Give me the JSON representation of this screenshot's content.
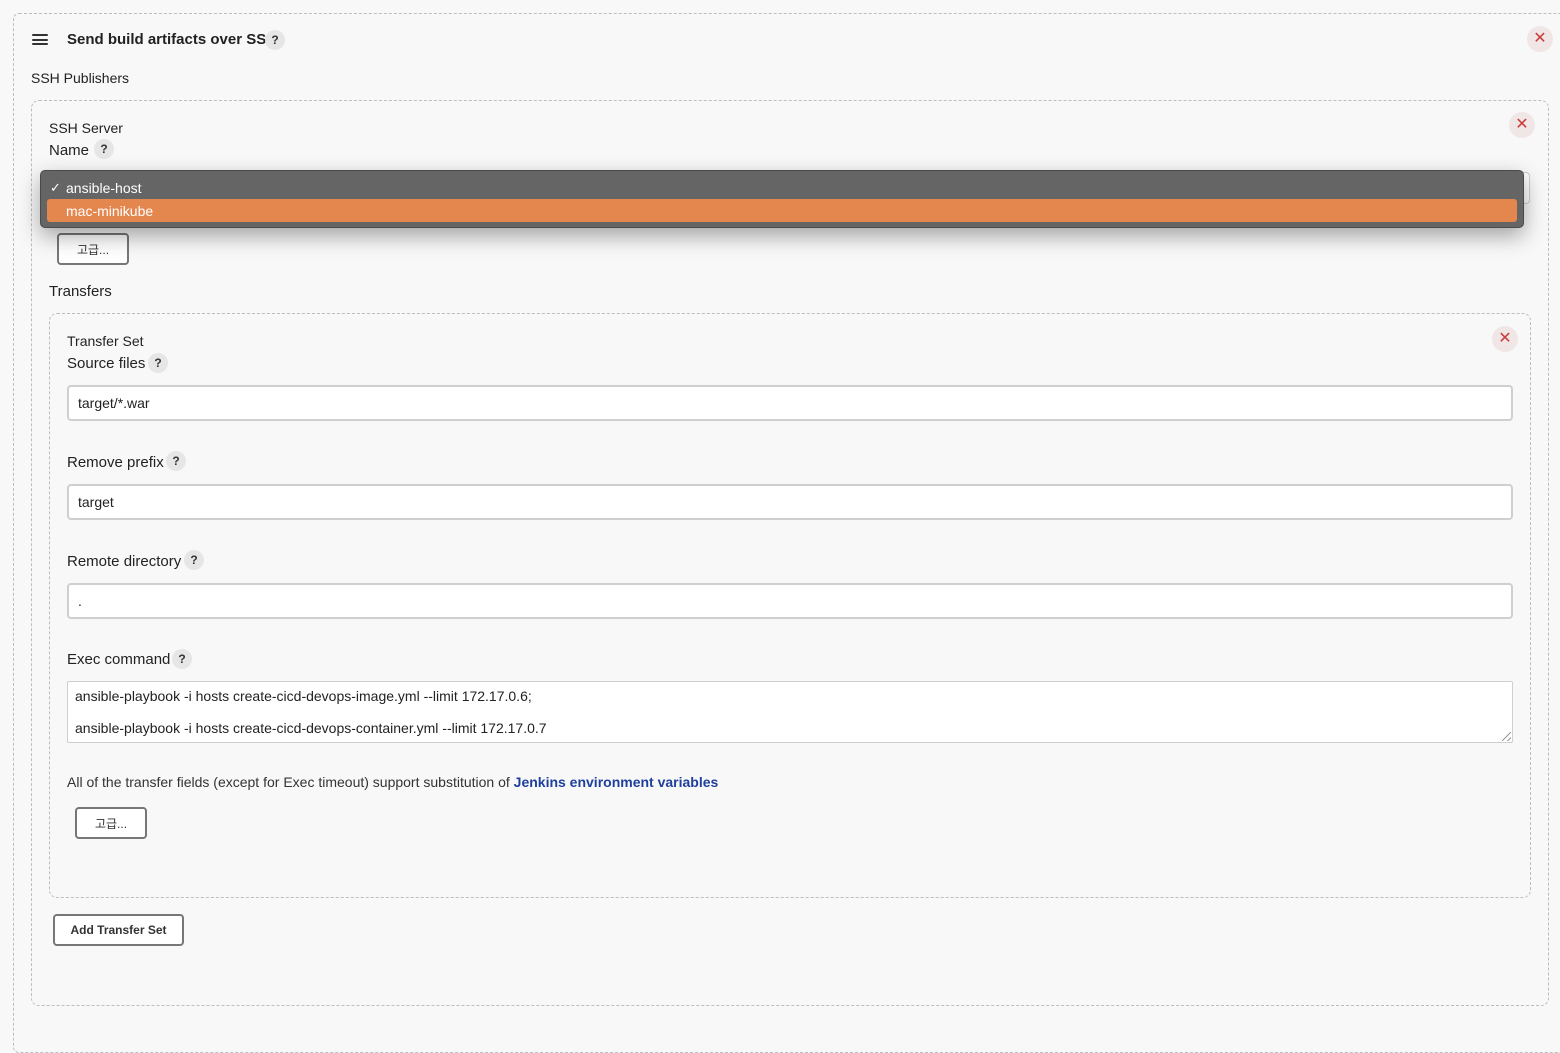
{
  "section": {
    "title": "Send build artifacts over SSH",
    "help": "?",
    "close": "✕",
    "publishers_label": "SSH Publishers"
  },
  "server": {
    "heading": "SSH Server",
    "name_label": "Name",
    "help": "?",
    "close": "✕",
    "advanced_label": "고급...",
    "dropdown": {
      "check": "✓",
      "options": [
        {
          "label": "ansible-host",
          "selected": true
        },
        {
          "label": "mac-minikube",
          "highlighted": true
        }
      ]
    }
  },
  "transfers": {
    "label": "Transfers",
    "set": {
      "heading": "Transfer Set",
      "close": "✕",
      "source_files": {
        "label": "Source files",
        "help": "?",
        "value": "target/*.war"
      },
      "remove_prefix": {
        "label": "Remove prefix",
        "help": "?",
        "value": "target"
      },
      "remote_directory": {
        "label": "Remote directory",
        "help": "?",
        "value": "."
      },
      "exec_command": {
        "label": "Exec command",
        "help": "?",
        "lines": [
          "ansible-playbook -i hosts create-cicd-devops-image.yml --limit 172.17.0.6;",
          "ansible-playbook -i hosts create-cicd-devops-container.yml --limit 172.17.0.7"
        ]
      },
      "note_prefix": "All of the transfer fields (except for Exec timeout) support substitution of ",
      "note_link": "Jenkins environment variables",
      "advanced_label": "고급..."
    },
    "add_button": "Add Transfer Set"
  }
}
